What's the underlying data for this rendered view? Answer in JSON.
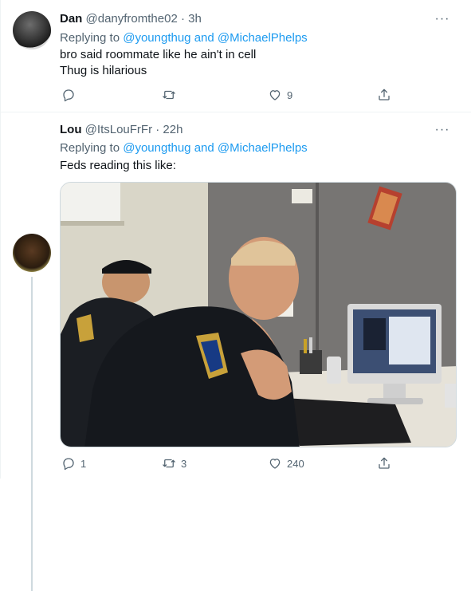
{
  "tweets": [
    {
      "name": "Dan",
      "handle": "@danyfromthe02",
      "dot": "·",
      "time": "3h",
      "replying_prefix": "Replying to",
      "mention_1": "@youngthug",
      "and": "and",
      "mention_2": "@MichaelPhelps",
      "line_1": "bro said roommate like he ain't in cell",
      "line_2": "Thug is hilarious",
      "reply_count": "",
      "retweet_count": "",
      "like_count": "9"
    },
    {
      "name": "Lou",
      "handle": "@ItsLouFrFr",
      "dot": "·",
      "time": "22h",
      "replying_prefix": "Replying to",
      "mention_1": "@youngthug",
      "and": "and",
      "mention_2": "@MichaelPhelps",
      "line_1": "Feds reading this like:",
      "reply_count": "1",
      "retweet_count": "3",
      "like_count": "240"
    }
  ],
  "more_glyph": "···",
  "icons": [
    "reply-icon",
    "retweet-icon",
    "like-icon",
    "share-icon",
    "more-icon"
  ],
  "colors": {
    "link": "#1d9bf0",
    "muted": "#536471",
    "text": "#0f1419"
  }
}
